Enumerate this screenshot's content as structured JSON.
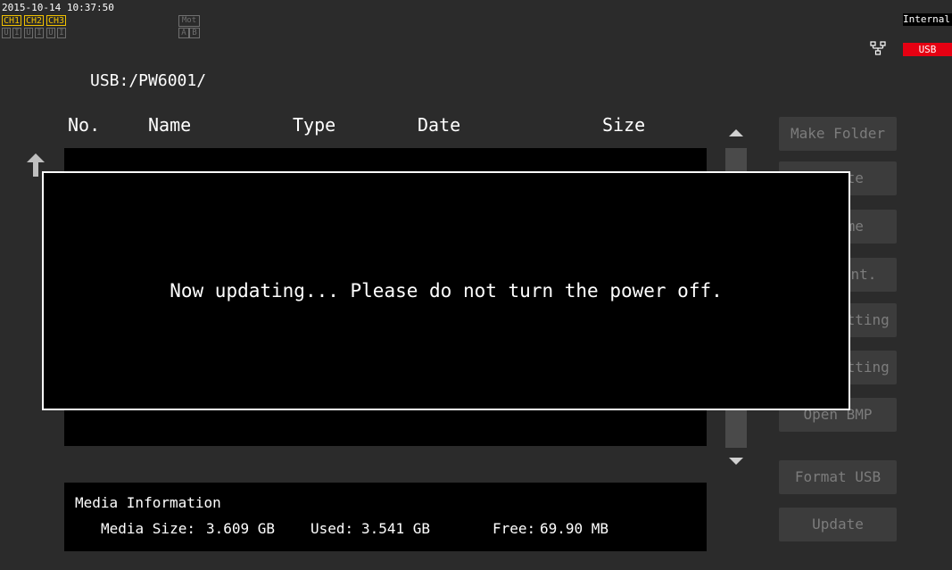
{
  "status": {
    "datetime": "2015-10-14 10:37:50",
    "channels": [
      "CH1",
      "CH2",
      "CH3"
    ],
    "ui_cells": [
      "U",
      "I",
      "U",
      "I",
      "U",
      "I"
    ],
    "mot": "Mot",
    "ab": [
      "A",
      "B"
    ],
    "storage_internal": "Internal",
    "storage_usb": "USB",
    "usb_color": "#e60012",
    "network_icon": "network-icon"
  },
  "path": "USB:/PW6001/",
  "table": {
    "columns": [
      "No.",
      "Name",
      "Type",
      "Date",
      "Size"
    ]
  },
  "buttons": [
    "Make Folder",
    "Delete",
    "Rename",
    "Copy Int. Mem.",
    "Save Setting",
    "Load Setting",
    "Open BMP",
    "Format USB",
    "Update"
  ],
  "modal": {
    "message": "Now updating... Please do not turn the power off."
  },
  "media": {
    "title": "Media Information",
    "size_label": "Media Size:",
    "size_value": "3.609 GB",
    "used_label": "Used:",
    "used_value": "3.541 GB",
    "free_label": "Free:",
    "free_value": "69.90 MB"
  }
}
